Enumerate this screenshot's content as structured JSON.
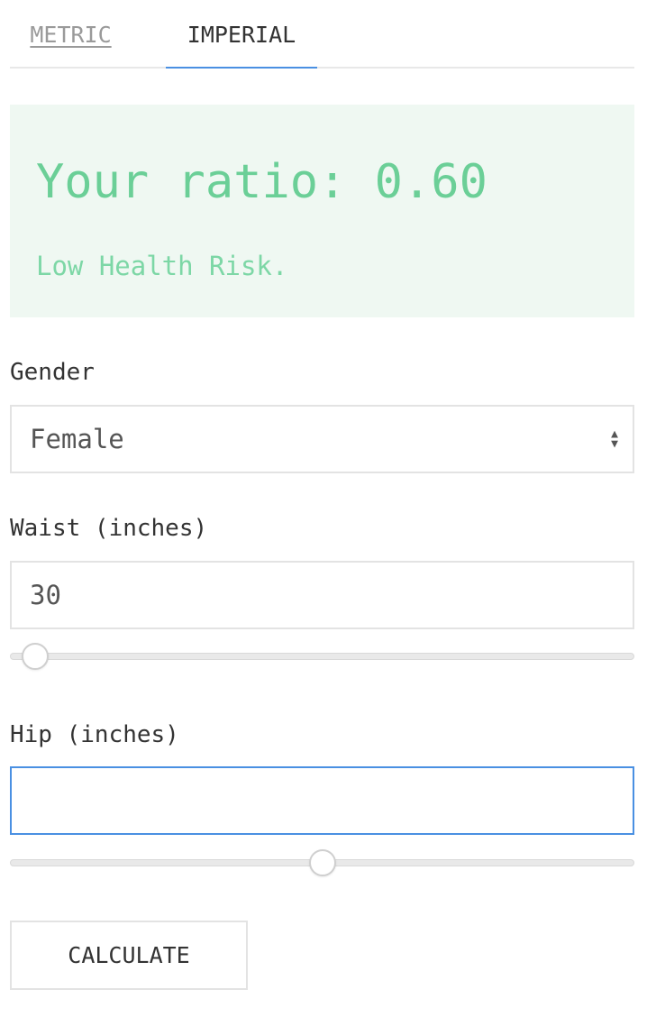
{
  "tabs": {
    "metric": "METRIC",
    "imperial": "IMPERIAL",
    "active": "imperial"
  },
  "result": {
    "title": "Your ratio: 0.60",
    "risk": "Low Health Risk."
  },
  "gender": {
    "label": "Gender",
    "value": "Female"
  },
  "waist": {
    "label": "Waist (inches)",
    "value": "30",
    "slider_fraction": 0.02
  },
  "hip": {
    "label": "Hip (inches)",
    "value": "",
    "slider_fraction": 0.5
  },
  "calculate_label": "CALCULATE",
  "colors": {
    "accent": "#4a90e2",
    "result_bg": "#eff8f2",
    "result_text": "#6bcf97"
  },
  "icons": {
    "select": "up-down-arrows-icon"
  }
}
